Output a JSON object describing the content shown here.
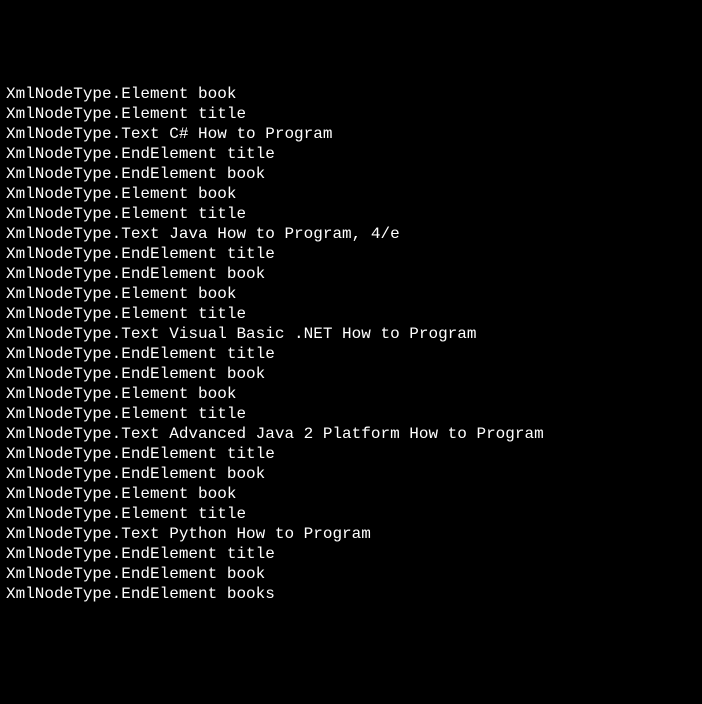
{
  "lines": [
    "XmlNodeType.Element book",
    "XmlNodeType.Element title",
    "XmlNodeType.Text C# How to Program",
    "XmlNodeType.EndElement title",
    "XmlNodeType.EndElement book",
    "XmlNodeType.Element book",
    "XmlNodeType.Element title",
    "XmlNodeType.Text Java How to Program, 4/e",
    "XmlNodeType.EndElement title",
    "XmlNodeType.EndElement book",
    "XmlNodeType.Element book",
    "XmlNodeType.Element title",
    "XmlNodeType.Text Visual Basic .NET How to Program",
    "XmlNodeType.EndElement title",
    "XmlNodeType.EndElement book",
    "XmlNodeType.Element book",
    "XmlNodeType.Element title",
    "XmlNodeType.Text Advanced Java 2 Platform How to Program",
    "XmlNodeType.EndElement title",
    "XmlNodeType.EndElement book",
    "XmlNodeType.Element book",
    "XmlNodeType.Element title",
    "XmlNodeType.Text Python How to Program",
    "XmlNodeType.EndElement title",
    "XmlNodeType.EndElement book",
    "XmlNodeType.EndElement books"
  ]
}
